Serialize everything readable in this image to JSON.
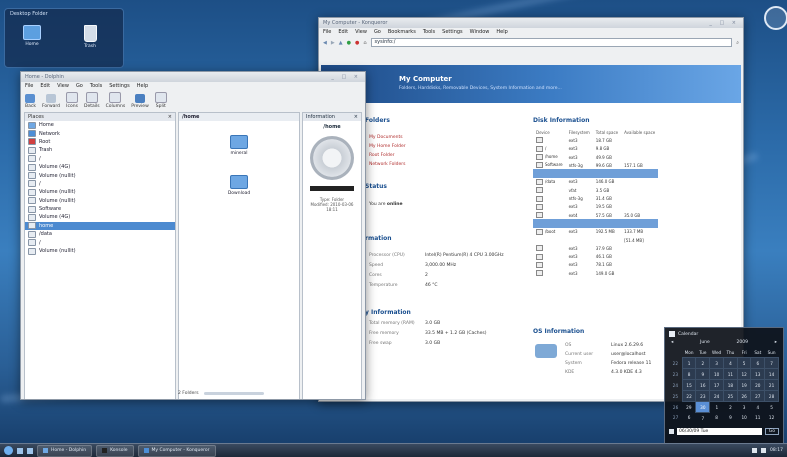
{
  "desktop": {
    "folderview_title": "Desktop Folder",
    "icons": [
      {
        "label": "Home",
        "icon": "home-folder-icon"
      },
      {
        "label": "Trash",
        "icon": "trash-icon"
      }
    ]
  },
  "dolphin": {
    "title": "Home - Dolphin",
    "menu": [
      "File",
      "Edit",
      "View",
      "Go",
      "Tools",
      "Settings",
      "Help"
    ],
    "toolbar": [
      "Back",
      "Forward",
      "Icons",
      "Details",
      "Columns",
      "Preview",
      "Split"
    ],
    "places_header": "Places",
    "places": [
      "Home",
      "Network",
      "Root",
      "Trash",
      "/",
      "Volume (4G)",
      "Volume (nullit)",
      "/",
      "Volume (nullit)",
      "Volume (nullit)",
      "Software",
      "Volume (4G)",
      "home",
      "/data",
      "/",
      "Volume (nullit)"
    ],
    "places_selected_index": 12,
    "breadcrumb": "/home",
    "files": [
      "mineral",
      "Download"
    ],
    "info_title": "Information",
    "info_name": "/home",
    "info_meta": [
      "Type: Folder",
      "Modified: 2010-03-06",
      "18:11"
    ],
    "status": "2 Folders"
  },
  "konqueror": {
    "title": "My Computer - Konqueror",
    "menu": [
      "File",
      "Edit",
      "View",
      "Go",
      "Bookmarks",
      "Tools",
      "Settings",
      "Window",
      "Help"
    ],
    "location": "sysinfo:/",
    "banner_title": "My Computer",
    "banner_subtitle": "Folders, Harddisks, Removable Devices, System Information and more...",
    "common_folders_title": "Folders",
    "common_folders": [
      "My Documents",
      "My Home Folder",
      "Root Folder",
      "Network Folders"
    ],
    "net_status_title": "Status",
    "net_status_label": "You are",
    "net_status_value": "online",
    "cpu_title": "rmation",
    "cpu_rows": [
      {
        "k": "Processor (CPU)",
        "v": "Intel(R) Pentium(R) 4 CPU 3.00GHz"
      },
      {
        "k": "Speed",
        "v": "3,000.00 MHz"
      },
      {
        "k": "Cores",
        "v": "2"
      },
      {
        "k": "Temperature",
        "v": "46 °C"
      }
    ],
    "mem_title": "y Information",
    "mem_rows": [
      {
        "k": "Total memory (RAM)",
        "v": "3.0 GB"
      },
      {
        "k": "Free memory",
        "v": "33.5 MB + 1.2 GB (Caches)"
      },
      {
        "k": "Free swap",
        "v": "3.0 GB"
      }
    ],
    "disk_title": "Disk Information",
    "disk_headers": [
      "Device",
      "Filesystem",
      "Total space",
      "Available space"
    ],
    "disks": [
      {
        "name": "",
        "fs": "ext3",
        "total": "18.7 GB",
        "avail": ""
      },
      {
        "name": "/",
        "fs": "ext3",
        "total": "9.8 GB",
        "avail": ""
      },
      {
        "name": "/home",
        "fs": "ext3",
        "total": "49.9 GB",
        "avail": ""
      },
      {
        "name": "Software",
        "fs": "ntfs-3g",
        "total": "99.6 GB",
        "avail": "157.1 GB"
      },
      {
        "name": "",
        "fs": "",
        "total": "",
        "avail": ""
      },
      {
        "name": "/data",
        "fs": "ext3",
        "total": "146.0 GB",
        "avail": ""
      },
      {
        "name": "",
        "fs": "vfat",
        "total": "3.5 GB",
        "avail": ""
      },
      {
        "name": "",
        "fs": "ntfs-3g",
        "total": "31.4 GB",
        "avail": ""
      },
      {
        "name": "",
        "fs": "ext3",
        "total": "19.5 GB",
        "avail": ""
      },
      {
        "name": "",
        "fs": "ext4",
        "total": "57.5 GB",
        "avail": "35.0 GB"
      },
      {
        "name": "",
        "fs": "",
        "total": "",
        "avail": ""
      },
      {
        "name": "/boot",
        "fs": "ext3",
        "total": "192.5 MB",
        "avail": "133.7 MB"
      },
      {
        "name": "",
        "fs": "",
        "total": "",
        "avail": "[51.4 MB]"
      },
      {
        "name": "",
        "fs": "ext3",
        "total": "37.9 GB",
        "avail": ""
      },
      {
        "name": "",
        "fs": "ext3",
        "total": "46.1 GB",
        "avail": ""
      },
      {
        "name": "",
        "fs": "ext3",
        "total": "78.1 GB",
        "avail": ""
      },
      {
        "name": "",
        "fs": "ext3",
        "total": "149.0 GB",
        "avail": ""
      }
    ],
    "os_title": "OS Information",
    "os_rows": [
      {
        "k": "OS",
        "v": "Linux 2.6.29.6"
      },
      {
        "k": "Current user",
        "v": "user@localhost"
      },
      {
        "k": "System",
        "v": "Fedora release 11"
      },
      {
        "k": "KDE",
        "v": "4.3.0 KDE 4.3"
      }
    ]
  },
  "calendar": {
    "title": "Calendar",
    "month": "June",
    "year": "2009",
    "weekdays": [
      "Mon",
      "Tue",
      "Wed",
      "Thu",
      "Fri",
      "Sat",
      "Sun"
    ],
    "weeks": [
      {
        "wk": "22",
        "days": [
          "1",
          "2",
          "3",
          "4",
          "5",
          "6",
          "7"
        ]
      },
      {
        "wk": "23",
        "days": [
          "8",
          "9",
          "10",
          "11",
          "12",
          "13",
          "14"
        ]
      },
      {
        "wk": "24",
        "days": [
          "15",
          "16",
          "17",
          "18",
          "19",
          "20",
          "21"
        ]
      },
      {
        "wk": "25",
        "days": [
          "22",
          "23",
          "24",
          "25",
          "26",
          "27",
          "28"
        ]
      },
      {
        "wk": "26",
        "days": [
          "29",
          "30",
          "1",
          "2",
          "3",
          "4",
          "5"
        ]
      },
      {
        "wk": "27",
        "days": [
          "6",
          "7",
          "8",
          "9",
          "10",
          "11",
          "12"
        ]
      }
    ],
    "today_index": [
      4,
      1
    ],
    "date_field": "06/30/09 Tue",
    "date_button": "Go"
  },
  "panel": {
    "tasks": [
      "Home - Dolphin",
      "Konsole",
      "My Computer - Konqueror"
    ],
    "clock": "08:17"
  }
}
